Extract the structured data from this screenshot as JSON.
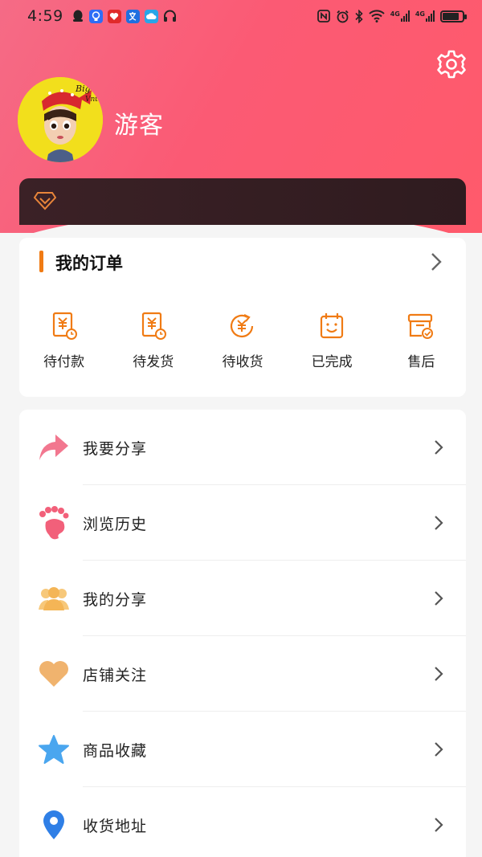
{
  "status_bar": {
    "time": "4:59",
    "net_label_1": "4G",
    "net_label_2": "4G",
    "battery_level": 0.85
  },
  "profile": {
    "username": "游客"
  },
  "orders": {
    "title": "我的订单",
    "items": [
      {
        "label": "待付款",
        "icon": "payment-pending-icon"
      },
      {
        "label": "待发货",
        "icon": "shipment-pending-icon"
      },
      {
        "label": "待收货",
        "icon": "receipt-pending-icon"
      },
      {
        "label": "已完成",
        "icon": "completed-icon"
      },
      {
        "label": "售后",
        "icon": "after-sales-icon"
      }
    ]
  },
  "menu": {
    "items": [
      {
        "label": "我要分享",
        "icon": "share-arrow-icon"
      },
      {
        "label": "浏览历史",
        "icon": "footprint-icon"
      },
      {
        "label": "我的分享",
        "icon": "users-icon"
      },
      {
        "label": "店铺关注",
        "icon": "heart-icon"
      },
      {
        "label": "商品收藏",
        "icon": "star-icon"
      },
      {
        "label": "收货地址",
        "icon": "location-pin-icon"
      }
    ]
  },
  "colors": {
    "header_start": "#f56b86",
    "header_end": "#ff5a6b",
    "accent_orange": "#f07b14",
    "vip_bar": "#3b2126"
  }
}
